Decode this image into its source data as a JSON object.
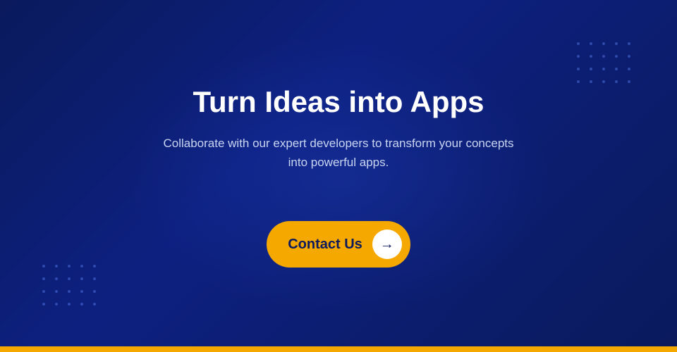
{
  "page": {
    "title": "Turn Ideas into Apps",
    "subtitle": "Collaborate with our expert developers to transform your concepts into powerful apps.",
    "cta": {
      "label": "Contact Us",
      "arrow": "→"
    },
    "colors": {
      "background_start": "#0a1a5c",
      "background_end": "#0d2080",
      "gold": "#f5a800",
      "text_primary": "#ffffff",
      "text_secondary": "#c8d4f0",
      "title_color": "#0d1a5c"
    },
    "dots": {
      "count": 20
    }
  }
}
